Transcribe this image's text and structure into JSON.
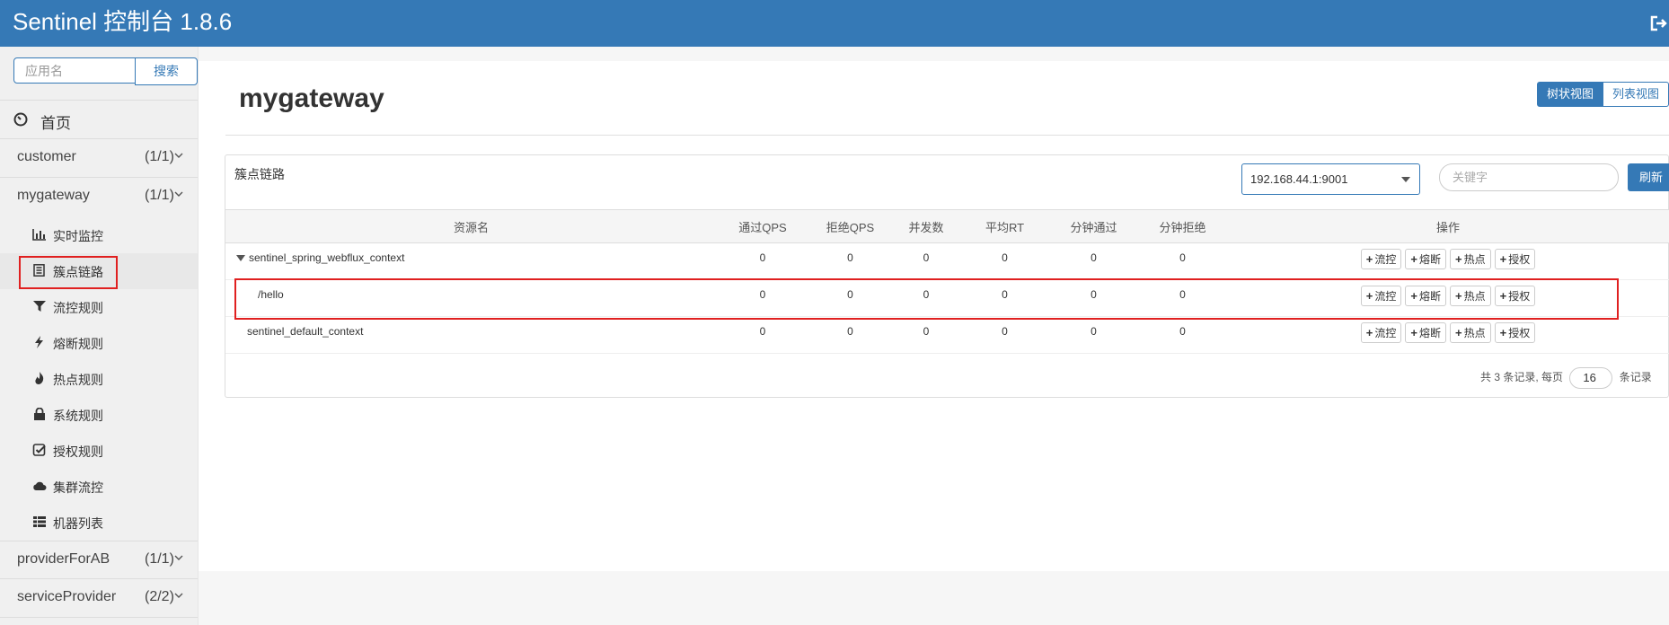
{
  "header": {
    "title": "Sentinel 控制台 1.8.6"
  },
  "sidebar": {
    "search_placeholder": "应用名",
    "search_button": "搜索",
    "home_label": "首页",
    "apps": [
      {
        "name": "customer",
        "count": "(1/1)"
      },
      {
        "name": "mygateway",
        "count": "(1/1)"
      },
      {
        "name": "providerForAB",
        "count": "(1/1)"
      },
      {
        "name": "serviceProvider",
        "count": "(2/2)"
      }
    ],
    "menu": [
      {
        "label": "实时监控",
        "icon": "bar-chart-icon"
      },
      {
        "label": "簇点链路",
        "icon": "list-icon"
      },
      {
        "label": "流控规则",
        "icon": "filter-icon"
      },
      {
        "label": "熔断规则",
        "icon": "bolt-icon"
      },
      {
        "label": "热点规则",
        "icon": "fire-icon"
      },
      {
        "label": "系统规则",
        "icon": "lock-icon"
      },
      {
        "label": "授权规则",
        "icon": "check-square-icon"
      },
      {
        "label": "集群流控",
        "icon": "cloud-icon"
      },
      {
        "label": "机器列表",
        "icon": "th-list-icon"
      }
    ]
  },
  "main": {
    "title": "mygateway",
    "view_tree": "树状视图",
    "view_list": "列表视图",
    "panel_title": "簇点链路",
    "machine": "192.168.44.1:9001",
    "keyword_placeholder": "关键字",
    "refresh": "刷新",
    "columns": [
      "资源名",
      "通过QPS",
      "拒绝QPS",
      "并发数",
      "平均RT",
      "分钟通过",
      "分钟拒绝",
      "操作"
    ],
    "rows": [
      {
        "name": "sentinel_spring_webflux_context",
        "pass_qps": "0",
        "block_qps": "0",
        "threads": "0",
        "avg_rt": "0",
        "min_pass": "0",
        "min_block": "0"
      },
      {
        "name": "/hello",
        "pass_qps": "0",
        "block_qps": "0",
        "threads": "0",
        "avg_rt": "0",
        "min_pass": "0",
        "min_block": "0"
      },
      {
        "name": "sentinel_default_context",
        "pass_qps": "0",
        "block_qps": "0",
        "threads": "0",
        "avg_rt": "0",
        "min_pass": "0",
        "min_block": "0"
      }
    ],
    "actions": {
      "flow": "流控",
      "degrade": "熔断",
      "hot": "热点",
      "auth": "授权",
      "plus": "+"
    },
    "pager": {
      "prefix": "共 3 条记录, 每页",
      "page_size": "16",
      "suffix": "条记录"
    }
  },
  "colors": {
    "brand": "#3579b6",
    "highlight": "#e02020"
  }
}
